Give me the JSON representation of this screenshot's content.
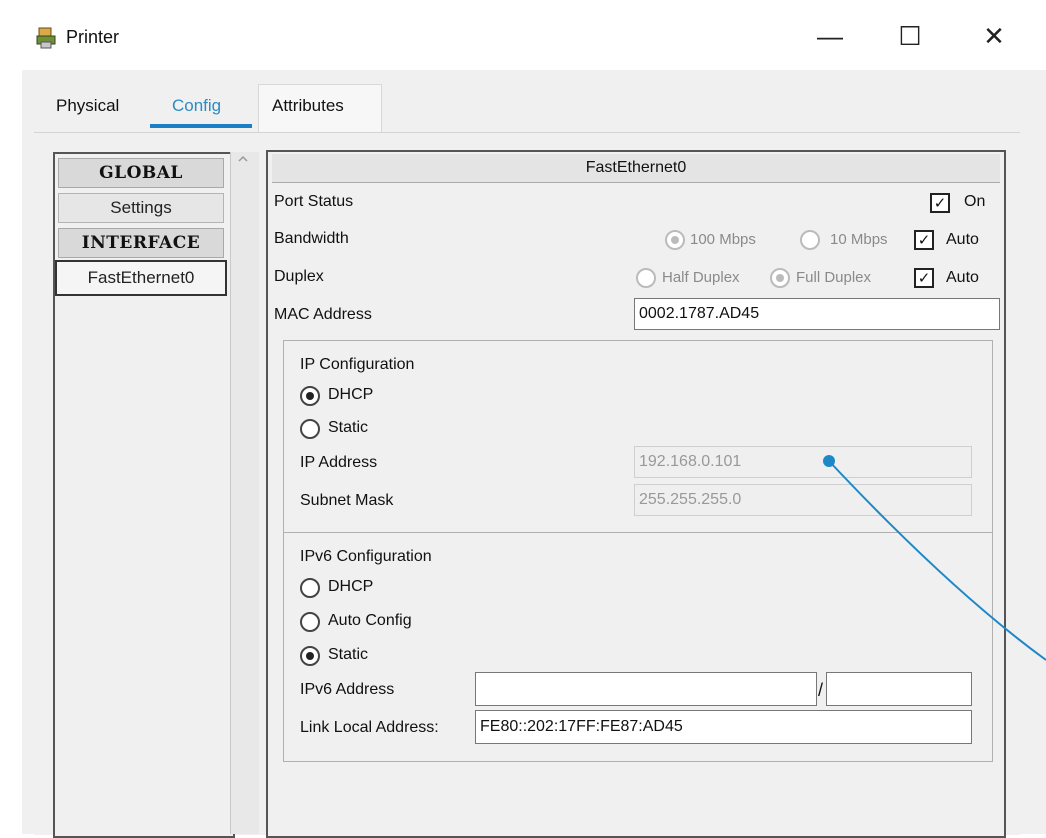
{
  "window": {
    "title": "Printer",
    "minimize": "—",
    "maximize": "☐",
    "close": "✕",
    "accent": "#1a7fc4"
  },
  "tabs": [
    {
      "label": "Physical"
    },
    {
      "label": "Config"
    },
    {
      "label": "Attributes"
    }
  ],
  "nav": {
    "global": "GLOBAL",
    "settings": "Settings",
    "interface": "INTERFACE",
    "fe": "FastEthernet0"
  },
  "panel": {
    "header": "FastEthernet0",
    "port_status": {
      "label": "Port Status",
      "on_label": "On"
    },
    "bandwidth": {
      "label": "Bandwidth",
      "opt100": "100 Mbps",
      "opt10": "10 Mbps",
      "auto": "Auto"
    },
    "duplex": {
      "label": "Duplex",
      "half": "Half Duplex",
      "full": "Full Duplex",
      "auto": "Auto"
    },
    "mac": {
      "label": "MAC Address",
      "value": "0002.1787.AD45"
    },
    "ip": {
      "title": "IP Configuration",
      "dhcp": "DHCP",
      "static": "Static",
      "addr_label": "IP Address",
      "addr_value": "192.168.0.101",
      "mask_label": "Subnet Mask",
      "mask_value": "255.255.255.0"
    },
    "ipv6": {
      "title": "IPv6 Configuration",
      "dhcp": "DHCP",
      "auto": "Auto Config",
      "static": "Static",
      "addr_label": "IPv6 Address",
      "addr_value": "",
      "prefix_sep": "/",
      "prefix_value": "",
      "link_label": "Link Local Address:",
      "link_value": "FE80::202:17FF:FE87:AD45"
    }
  }
}
